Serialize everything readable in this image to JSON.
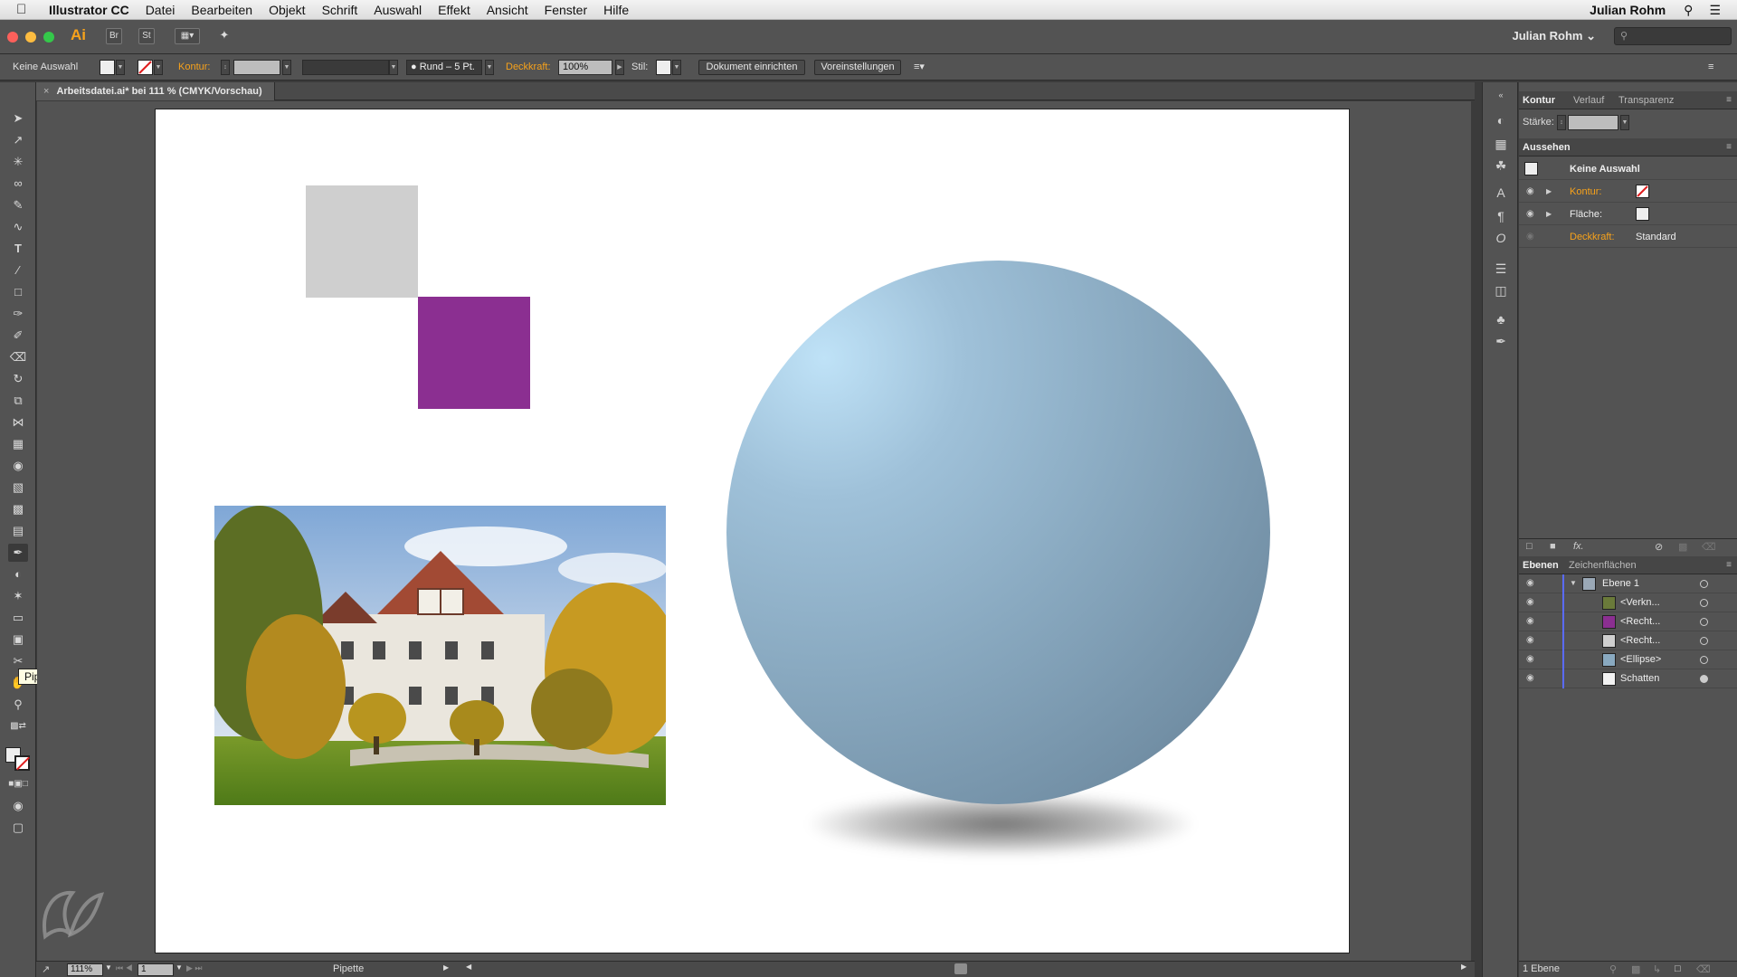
{
  "menubar": {
    "app_name": "Illustrator CC",
    "items": [
      "Datei",
      "Bearbeiten",
      "Objekt",
      "Schrift",
      "Auswahl",
      "Effekt",
      "Ansicht",
      "Fenster",
      "Hilfe"
    ],
    "user": "Julian Rohm"
  },
  "appbar": {
    "logo": "Ai",
    "bridge": "Br",
    "stock": "St",
    "user": "Julian Rohm ⌄",
    "search_placeholder": ""
  },
  "controlbar": {
    "selection": "Keine Auswahl",
    "kontur_label": "Kontur:",
    "brush_label": "Rund – 5 Pt.",
    "deckkraft_label": "Deckkraft:",
    "deckkraft_value": "100%",
    "stil_label": "Stil:",
    "dokument_button": "Dokument einrichten",
    "voreinstellungen_button": "Voreinstellungen"
  },
  "document": {
    "tab_title": "Arbeitsdatei.ai* bei 111 % (CMYK/Vorschau)"
  },
  "toolbar": {
    "tooltip": "Pipette-Werkzeug (I)"
  },
  "statusbar": {
    "zoom": "111%",
    "artboard": "1",
    "tool": "Pipette"
  },
  "panels": {
    "stroke_tabs": [
      "Kontur",
      "Verlauf",
      "Transparenz"
    ],
    "staerke_label": "Stärke:",
    "aussehen_title": "Aussehen",
    "aussehen_selection": "Keine Auswahl",
    "kontur_label": "Kontur:",
    "flaeche_label": "Fläche:",
    "deckkraft_label": "Deckkraft:",
    "deckkraft_value": "Standard",
    "fx": "fx.",
    "layer_tabs": [
      "Ebenen",
      "Zeichenflächen"
    ],
    "layers": [
      {
        "name": "Ebene 1",
        "thumb": "#9aa8b6"
      },
      {
        "name": "<Verkn...",
        "thumb": "#6a7a3a"
      },
      {
        "name": "<Recht...",
        "thumb": "#8b2f91"
      },
      {
        "name": "<Recht...",
        "thumb": "#cfcfcf"
      },
      {
        "name": "<Ellipse>",
        "thumb": "#89a9c0"
      },
      {
        "name": "Schatten",
        "thumb": "#f2f2f2"
      }
    ],
    "layers_count": "1 Ebene"
  },
  "colors": {
    "accent": "#f7a21b",
    "purple": "#8b2f91",
    "gray": "#cfcfcf",
    "sphere": "#89a9c0"
  }
}
